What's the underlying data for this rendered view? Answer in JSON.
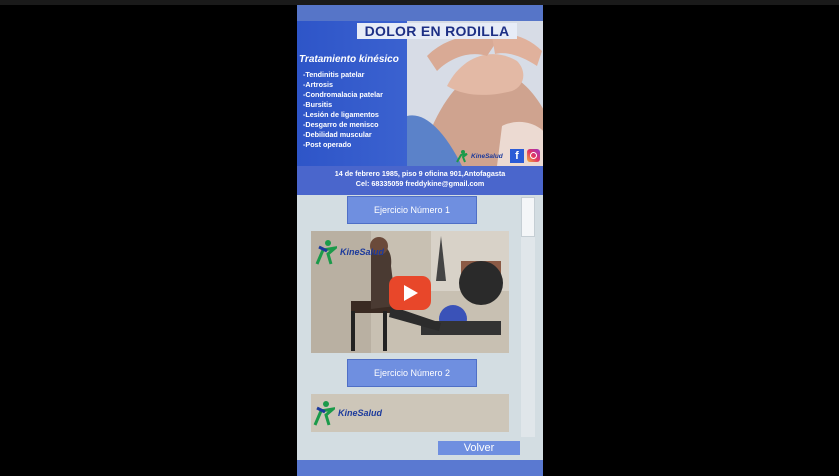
{
  "header": {
    "title": "DOLOR EN RODILLA",
    "treatment_title": "Tratamiento kinésico",
    "conditions": [
      "-Tendinitis patelar",
      "-Artrosis",
      "-Condromalacia patelar",
      "-Bursitis",
      "-Lesión de ligamentos",
      "-Desgarro de menisco",
      "-Debilidad muscular",
      "-Post operado"
    ],
    "logo_text": "KineSalud",
    "address": "14 de febrero 1985, piso 9 oficina 901,Antofagasta",
    "contact": "Cel: 68335059 freddykine@gmail.com"
  },
  "exercises": [
    {
      "label": "Ejercicio Número 1",
      "video_logo": "KineSalud"
    },
    {
      "label": "Ejercicio Número 2",
      "video_logo": "KineSalud"
    }
  ],
  "back_label": "Volver",
  "icons": [
    "facebook-icon",
    "instagram-icon",
    "play-icon",
    "kinesalud-logo-icon"
  ],
  "colors": {
    "accent": "#6f8fe0",
    "header_blue": "#3b62d0",
    "background": "#d3dde2",
    "play_red": "#e8472a"
  }
}
